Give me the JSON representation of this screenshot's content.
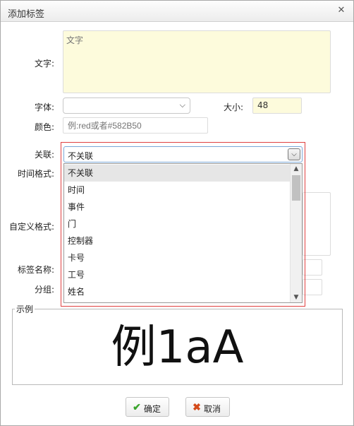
{
  "window": {
    "title": "添加标签",
    "close_glyph": "✕"
  },
  "form": {
    "text_label": "文字:",
    "text_placeholder": "文字",
    "font_label": "字体:",
    "font_value": "",
    "size_label": "大小:",
    "size_value": "48",
    "color_label": "颜色:",
    "color_placeholder": "例:red或者#582B50",
    "relate_label": "关联:",
    "relate_value": "不关联",
    "time_format_label": "时间格式:",
    "custom_format_label": "自定义格式:",
    "tag_name_label": "标签名称:",
    "group_label": "分组:"
  },
  "dropdown": {
    "options": [
      "不关联",
      "时间",
      "事件",
      "门",
      "控制器",
      "卡号",
      "工号",
      "姓名"
    ],
    "selected_index": 0
  },
  "sample": {
    "legend": "示例",
    "text": "例1aA"
  },
  "buttons": {
    "ok": "确定",
    "cancel": "取消"
  },
  "icons": {
    "close": "close-icon",
    "chevron": "chevron-down-icon",
    "ok": "check-icon",
    "cancel": "cross-icon"
  },
  "colors": {
    "highlight_border": "#e04040",
    "input_yellow": "#fdfbdc",
    "ok_icon": "#3aa52c",
    "cancel_icon": "#d44a1a"
  }
}
